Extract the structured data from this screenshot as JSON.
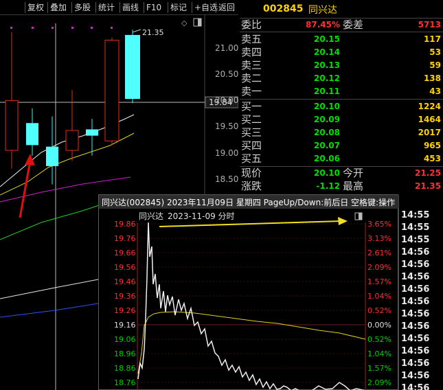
{
  "toolbar": {
    "items": [
      "复权",
      "叠加",
      "多股",
      "统计",
      "画线",
      "F10",
      "标记",
      "+自选",
      "返回"
    ]
  },
  "stock": {
    "code": "002845",
    "name": "同兴达"
  },
  "order_book": {
    "ratio": {
      "label": "委比",
      "value": "87.45%",
      "diff_label": "委差",
      "diff_value": "5713"
    },
    "asks": [
      {
        "label": "卖五",
        "price": "20.15",
        "volume": "117"
      },
      {
        "label": "卖四",
        "price": "20.14",
        "volume": "53"
      },
      {
        "label": "卖三",
        "price": "20.13",
        "volume": "59"
      },
      {
        "label": "卖二",
        "price": "20.12",
        "volume": "138"
      },
      {
        "label": "卖一",
        "price": "20.11",
        "volume": "43"
      }
    ],
    "bids": [
      {
        "label": "买一",
        "price": "20.10",
        "volume": "1224"
      },
      {
        "label": "买二",
        "price": "20.09",
        "volume": "1464"
      },
      {
        "label": "买三",
        "price": "20.08",
        "volume": "2017"
      },
      {
        "label": "买四",
        "price": "20.07",
        "volume": "965"
      },
      {
        "label": "买五",
        "price": "20.06",
        "volume": "453"
      }
    ],
    "quote": {
      "last_label": "现价",
      "last": "20.10",
      "open_label": "今开",
      "open": "21.25",
      "chg_label": "涨跌",
      "chg": "-1.12",
      "high_label": "最高",
      "high": "21.35"
    }
  },
  "kline": {
    "y_ticks": [
      "21.00",
      "20.50",
      "20.00",
      "19.50",
      "19.00",
      "18.50"
    ],
    "y_values": [
      21.0,
      20.5,
      20.0,
      19.5,
      19.0,
      18.5
    ],
    "crosshair_price": "19.84",
    "high_marker": "21.35",
    "candles": [
      {
        "open": 20.0,
        "close": 19.05,
        "high": 21.3,
        "low": 18.7,
        "type": "down"
      },
      {
        "open": 19.15,
        "close": 19.57,
        "high": 19.85,
        "low": 18.95,
        "type": "up"
      },
      {
        "open": 18.75,
        "close": 19.12,
        "high": 19.7,
        "low": 18.4,
        "type": "up"
      },
      {
        "open": 19.43,
        "close": 19.05,
        "high": 20.2,
        "low": 18.85,
        "type": "down"
      },
      {
        "open": 19.33,
        "close": 19.45,
        "high": 19.65,
        "low": 18.95,
        "type": "up"
      },
      {
        "open": 21.15,
        "close": 19.23,
        "high": 21.2,
        "low": 19.15,
        "type": "down"
      },
      {
        "open": 20.03,
        "close": 21.25,
        "high": 21.35,
        "low": 19.95,
        "type": "up"
      }
    ]
  },
  "intraday": {
    "title": "同兴达(002845) 2023年11月09日 星期四 PageUp/Down:前后日 空格键:操作",
    "subtitle_name": "同兴达",
    "subtitle_date": "2023-11-09 分时",
    "price_ticks": [
      "19.86",
      "19.76",
      "19.66",
      "19.56",
      "19.46",
      "19.36",
      "19.26",
      "19.16",
      "19.06",
      "18.96",
      "18.86",
      "18.76"
    ],
    "pct_ticks": [
      "3.65%",
      "3.13%",
      "2.61%",
      "2.09%",
      "1.57%",
      "1.04%",
      "0.52%",
      "0.00%",
      "0.52%",
      "1.04%",
      "1.57%",
      "2.09%"
    ],
    "up_color": "#ff3030",
    "down_color": "#00d000",
    "flat_color": "#e0e0e0"
  },
  "time_column": {
    "items": [
      "14:55",
      "14:55",
      "14:55",
      "14:56",
      "14:56",
      "14:56",
      "14:56",
      "14:56",
      "14:56",
      "14:56",
      "14:56",
      "14:56",
      "14:56",
      "14:56",
      "14:56"
    ]
  }
}
